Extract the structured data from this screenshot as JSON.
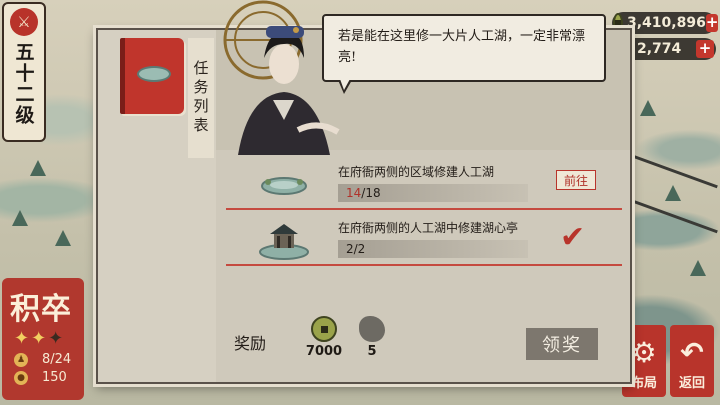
{
  "level": {
    "icon": "sword-emblem-icon",
    "text": "五十二级"
  },
  "currency": [
    {
      "icon": "copper-coin-icon",
      "value": "3,410,896",
      "plus": "+"
    },
    {
      "icon": "jade-gem-icon",
      "value": "2,774",
      "plus": "+"
    }
  ],
  "army": {
    "title": "积卒",
    "stars_on": "✦✦",
    "stars_off": "✦",
    "rows": [
      {
        "icon": "soldier-icon",
        "value": "8/24"
      },
      {
        "icon": "grain-icon",
        "value": "150"
      }
    ]
  },
  "buttons": {
    "layout": {
      "icon": "layout-icon",
      "label": "布局"
    },
    "back": {
      "icon": "return-arrow-icon",
      "label": "返回"
    }
  },
  "dialog": {
    "tab_label": "任务列表",
    "speech": "若是能在这里修一大片人工湖，一定非常漂亮!",
    "tasks": [
      {
        "thumb": "lake-thumbnail",
        "desc": "在府衙两侧的区域修建人工湖",
        "current": "14",
        "total": "/18",
        "action": "前往"
      },
      {
        "thumb": "pavilion-thumbnail",
        "desc": "在府衙两侧的人工湖中修建湖心亭",
        "current": "2/2",
        "total": "",
        "status": "completed"
      }
    ],
    "reward_label": "奖励",
    "rewards": [
      {
        "icon": "copper-coin-icon",
        "amount": "7000"
      },
      {
        "icon": "ore-stone-icon",
        "amount": "5"
      }
    ],
    "claim_label": "领奖"
  },
  "colors": {
    "accent_red": "#b8342b",
    "panel": "#c8c2b2",
    "progress_red": "#b0322a"
  }
}
